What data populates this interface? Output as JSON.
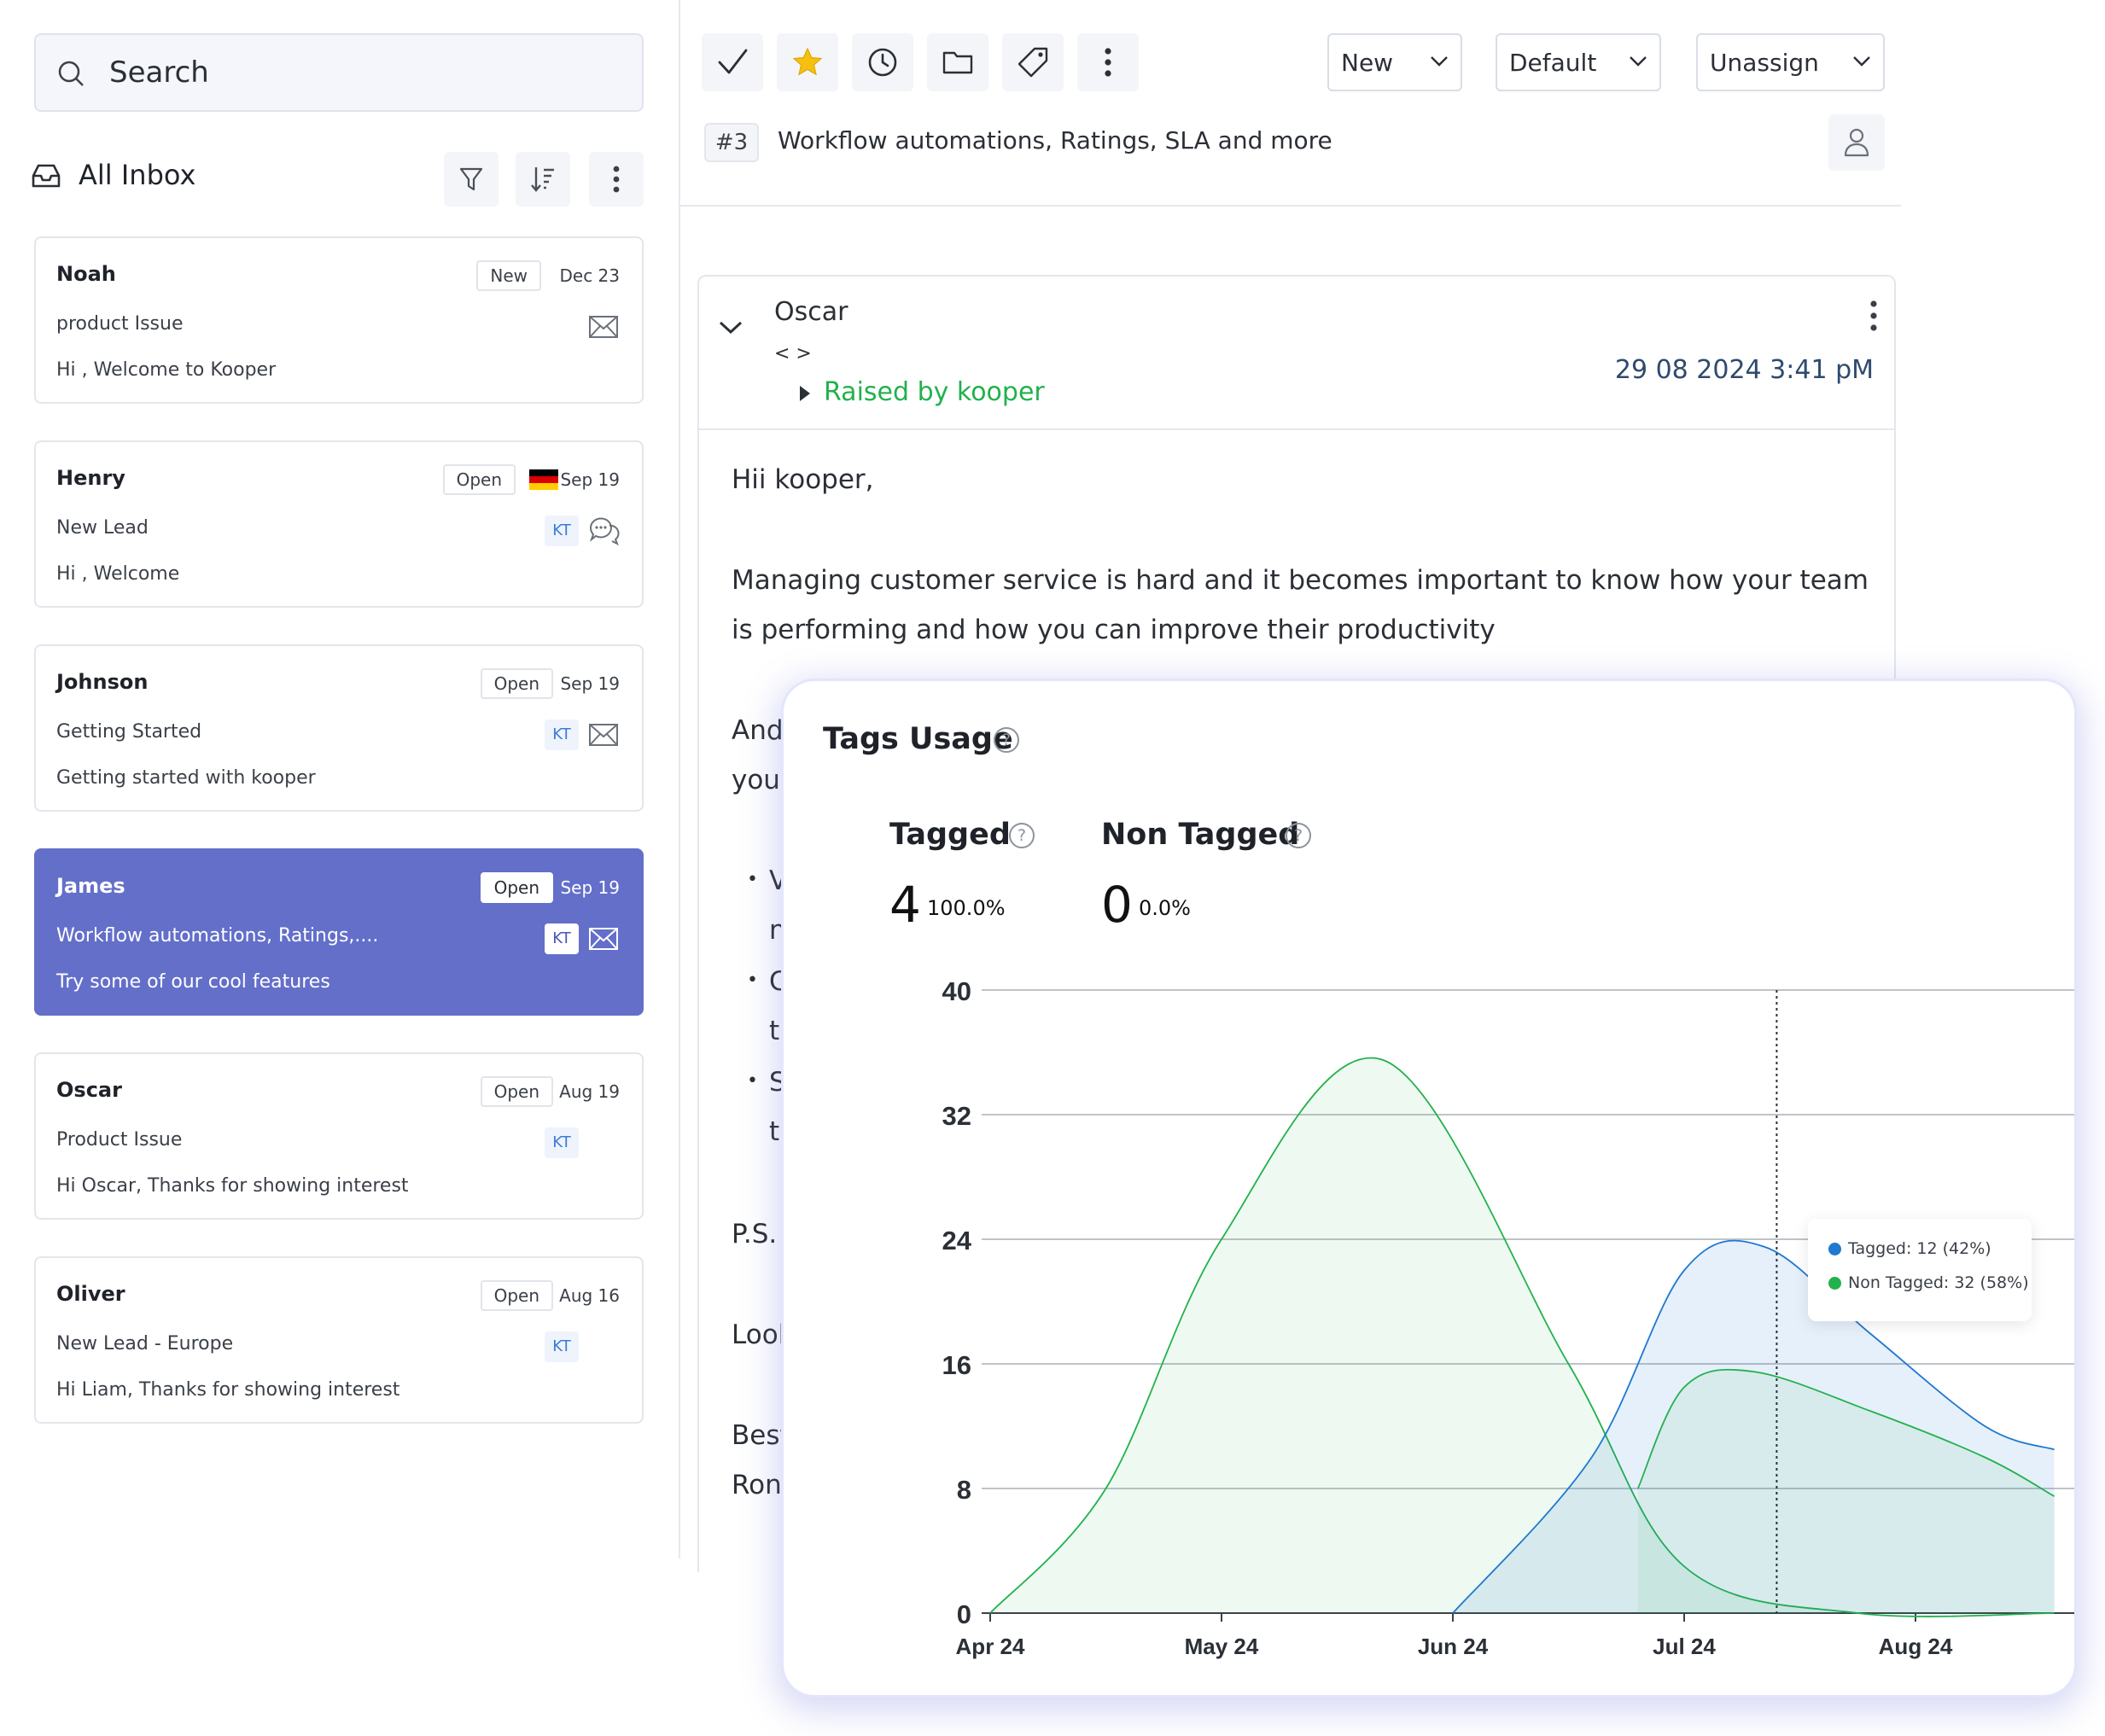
{
  "search": {
    "placeholder": "Search"
  },
  "inbox": {
    "title": "All Inbox"
  },
  "conversations": [
    {
      "name": "Noah",
      "status": "New",
      "date": "Dec 23",
      "subject": "product Issue",
      "preview": "Hi , Welcome to Kooper",
      "kt": "",
      "channel_icon": "envelope-icon",
      "flag": ""
    },
    {
      "name": "Henry",
      "status": "Open",
      "date": "Sep 19",
      "subject": "New Lead",
      "preview": "Hi , Welcome",
      "kt": "KT",
      "channel_icon": "chat-bubbles-icon",
      "flag": "germany-flag-icon"
    },
    {
      "name": "Johnson",
      "status": "Open",
      "date": "Sep 19",
      "subject": "Getting Started",
      "preview": "Getting started with kooper",
      "kt": "KT",
      "channel_icon": "envelope-icon",
      "flag": ""
    },
    {
      "name": "James",
      "status": "Open",
      "date": "Sep 19",
      "subject": "Workflow automations, Ratings,....",
      "preview": "Try some of our cool features",
      "kt": "KT",
      "channel_icon": "envelope-icon",
      "flag": "",
      "active": true
    },
    {
      "name": "Oscar",
      "status": "Open",
      "date": "Aug 19",
      "subject": "Product Issue",
      "preview": "Hi Oscar, Thanks for showing interest",
      "kt": "KT",
      "channel_icon": "",
      "flag": ""
    },
    {
      "name": "Oliver",
      "status": "Open",
      "date": "Aug 16",
      "subject": "New Lead - Europe",
      "preview": "Hi Liam, Thanks for showing interest",
      "kt": "KT",
      "channel_icon": "",
      "flag": ""
    }
  ],
  "toolbar": {
    "icons": [
      "check-icon",
      "star-icon",
      "clock-icon",
      "folder-icon",
      "tag-icon",
      "more-vertical-icon"
    ],
    "status_select": "New",
    "priority_select": "Default",
    "assign_select": "Unassign"
  },
  "ticket": {
    "number": "#3",
    "title": "Workflow automations, Ratings, SLA and more"
  },
  "message": {
    "from": "Oscar",
    "address": "< >",
    "raised_by": "Raised by kooper",
    "timestamp": "29 08 2024 3:41 pM",
    "lines": [
      "Hii kooper,",
      "Managing customer service is hard and it becomes important to know how your team",
      "is performing and how you can improve their productivity",
      "And",
      "your",
      "V",
      "n",
      "C",
      "tl",
      "S",
      "tl",
      "P.S.",
      "Lool",
      "Best",
      "Ron"
    ]
  },
  "colors": {
    "accent": "#636fc9",
    "tagged": "#1f78d1",
    "non_tagged": "#22b14c",
    "raised": "#22b14c"
  },
  "chart_card": {
    "title": "Tags Usage",
    "stats": [
      {
        "label": "Tagged",
        "value": "4",
        "percent": "100.0%"
      },
      {
        "label": "Non Tagged",
        "value": "0",
        "percent": "0.0%"
      }
    ],
    "tooltip": {
      "tagged": "Tagged: 12 (42%)",
      "non_tagged": "Non Tagged: 32 (58%)"
    }
  },
  "chart_data": {
    "type": "area",
    "title": "Tags Usage",
    "x": [
      "Apr 24",
      "May 24",
      "Jun 24",
      "Jul 24",
      "Aug 24"
    ],
    "ylim": [
      0,
      40
    ],
    "yticks": [
      0,
      8,
      16,
      24,
      32,
      40
    ],
    "grid": true,
    "series": [
      {
        "name": "Non Tagged",
        "color": "#22b14c",
        "points": [
          [
            0,
            0
          ],
          [
            0.5,
            8
          ],
          [
            1.0,
            24
          ],
          [
            1.7,
            35.5
          ],
          [
            2.5,
            16
          ],
          [
            3.0,
            3
          ],
          [
            3.75,
            0
          ],
          [
            4.6,
            0
          ]
        ]
      },
      {
        "name": "Tagged",
        "color": "#1f78d1",
        "points": [
          [
            2.0,
            0
          ],
          [
            2.6,
            10
          ],
          [
            3.0,
            22
          ],
          [
            3.35,
            23.5
          ],
          [
            3.8,
            18
          ],
          [
            4.3,
            12
          ],
          [
            4.6,
            10.5
          ]
        ]
      },
      {
        "name": "Non Tagged",
        "color": "#22b14c",
        "points": [
          [
            2.8,
            8
          ],
          [
            3.0,
            14.5
          ],
          [
            3.3,
            15.5
          ],
          [
            3.8,
            13
          ],
          [
            4.3,
            10
          ],
          [
            4.6,
            7.5
          ]
        ]
      }
    ],
    "hover_x": 3.4
  }
}
